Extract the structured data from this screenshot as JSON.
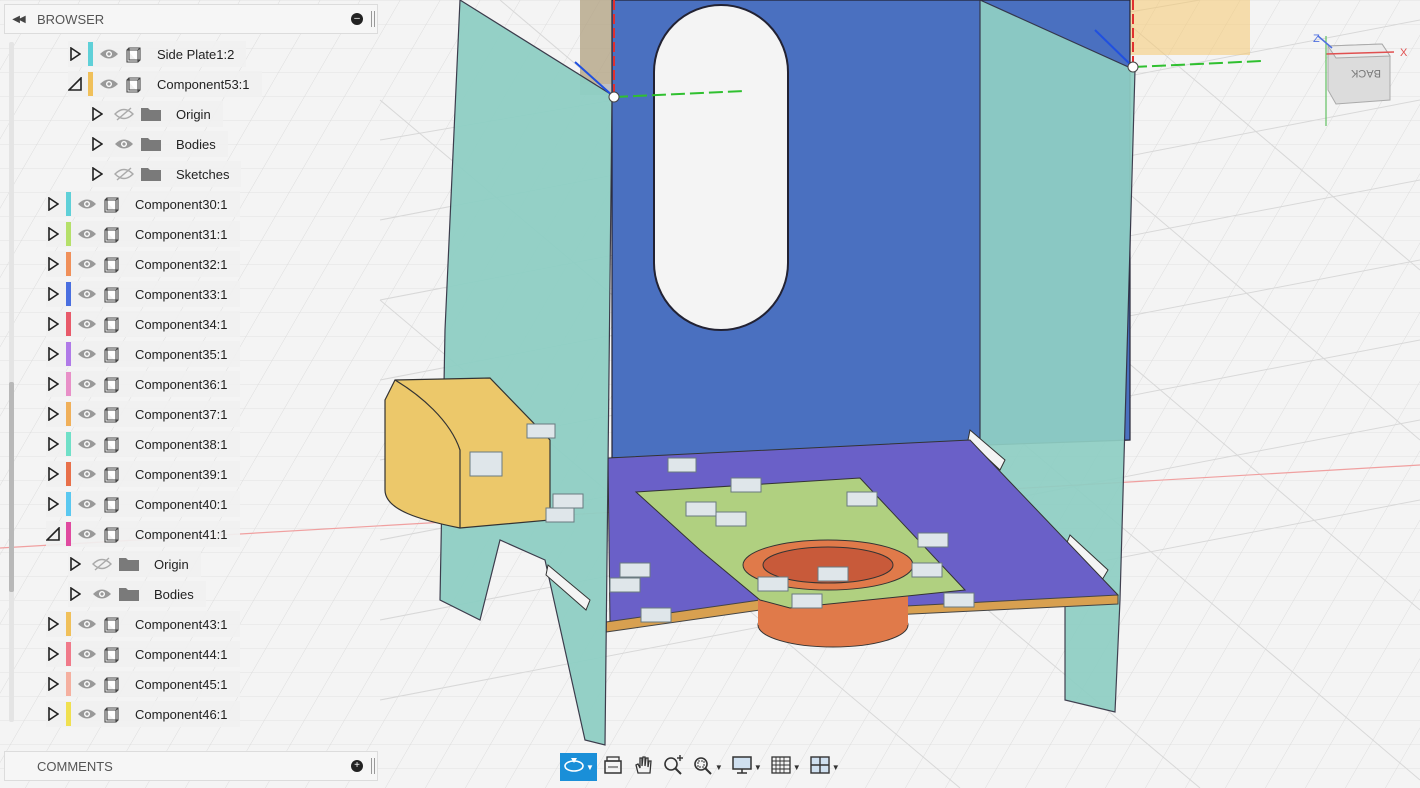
{
  "browser": {
    "title": "BROWSER",
    "tree": [
      {
        "label": "Side Plate1:2",
        "depth": 1,
        "expander": "collapsed",
        "kind": "component",
        "color": "#5fd0d8",
        "visible": true
      },
      {
        "label": "Component53:1",
        "depth": 1,
        "expander": "expanded",
        "kind": "component",
        "color": "#f0c05a",
        "visible": true
      },
      {
        "label": "Origin",
        "depth": 2,
        "expander": "collapsed",
        "kind": "folder",
        "color": null,
        "visible": false
      },
      {
        "label": "Bodies",
        "depth": 2,
        "expander": "collapsed",
        "kind": "folder",
        "color": null,
        "visible": true
      },
      {
        "label": "Sketches",
        "depth": 2,
        "expander": "collapsed",
        "kind": "folder",
        "color": null,
        "visible": false
      },
      {
        "label": "Component30:1",
        "depth": 0,
        "expander": "collapsed",
        "kind": "component",
        "color": "#5fd0d8",
        "visible": true
      },
      {
        "label": "Component31:1",
        "depth": 0,
        "expander": "collapsed",
        "kind": "component",
        "color": "#b5e06a",
        "visible": true
      },
      {
        "label": "Component32:1",
        "depth": 0,
        "expander": "collapsed",
        "kind": "component",
        "color": "#f0905a",
        "visible": true
      },
      {
        "label": "Component33:1",
        "depth": 0,
        "expander": "collapsed",
        "kind": "component",
        "color": "#4a6fe0",
        "visible": true
      },
      {
        "label": "Component34:1",
        "depth": 0,
        "expander": "collapsed",
        "kind": "component",
        "color": "#e85a6a",
        "visible": true
      },
      {
        "label": "Component35:1",
        "depth": 0,
        "expander": "collapsed",
        "kind": "component",
        "color": "#b07ae8",
        "visible": true
      },
      {
        "label": "Component36:1",
        "depth": 0,
        "expander": "collapsed",
        "kind": "component",
        "color": "#e890c8",
        "visible": true
      },
      {
        "label": "Component37:1",
        "depth": 0,
        "expander": "collapsed",
        "kind": "component",
        "color": "#f0b05a",
        "visible": true
      },
      {
        "label": "Component38:1",
        "depth": 0,
        "expander": "collapsed",
        "kind": "component",
        "color": "#70e0c8",
        "visible": true
      },
      {
        "label": "Component39:1",
        "depth": 0,
        "expander": "collapsed",
        "kind": "component",
        "color": "#e8704a",
        "visible": true
      },
      {
        "label": "Component40:1",
        "depth": 0,
        "expander": "collapsed",
        "kind": "component",
        "color": "#5ac8f0",
        "visible": true
      },
      {
        "label": "Component41:1",
        "depth": 0,
        "expander": "expanded",
        "kind": "component",
        "color": "#e04aa0",
        "visible": true
      },
      {
        "label": "Origin",
        "depth": 1,
        "expander": "collapsed",
        "kind": "folder",
        "color": null,
        "visible": false
      },
      {
        "label": "Bodies",
        "depth": 1,
        "expander": "collapsed",
        "kind": "folder",
        "color": null,
        "visible": true
      },
      {
        "label": "Component43:1",
        "depth": 0,
        "expander": "collapsed",
        "kind": "component",
        "color": "#f0c05a",
        "visible": true
      },
      {
        "label": "Component44:1",
        "depth": 0,
        "expander": "collapsed",
        "kind": "component",
        "color": "#f07a8a",
        "visible": true
      },
      {
        "label": "Component45:1",
        "depth": 0,
        "expander": "collapsed",
        "kind": "component",
        "color": "#f5b0a0",
        "visible": true
      },
      {
        "label": "Component46:1",
        "depth": 0,
        "expander": "collapsed",
        "kind": "component",
        "color": "#f0e050",
        "visible": true
      }
    ]
  },
  "comments": {
    "title": "COMMENTS"
  },
  "viewcube": {
    "face_label": "BACK",
    "axis_x": "X",
    "axis_z": "Z"
  },
  "toolbar": [
    {
      "name": "orbit-tool",
      "icon": "orbit-icon",
      "active": true,
      "dropdown": true
    },
    {
      "name": "look-at-tool",
      "icon": "camera-icon",
      "active": false,
      "dropdown": false
    },
    {
      "name": "pan-tool",
      "icon": "hand-icon",
      "active": false,
      "dropdown": false
    },
    {
      "name": "zoom-tool",
      "icon": "zoom-plus-icon",
      "active": false,
      "dropdown": false
    },
    {
      "name": "zoom-window-tool",
      "icon": "zoom-window-icon",
      "active": false,
      "dropdown": true
    },
    {
      "name": "display-settings-tool",
      "icon": "monitor-icon",
      "active": false,
      "dropdown": true
    },
    {
      "name": "grid-settings-tool",
      "icon": "grid-icon",
      "active": false,
      "dropdown": true
    },
    {
      "name": "viewports-tool",
      "icon": "viewports-icon",
      "active": false,
      "dropdown": true
    }
  ],
  "colors": {
    "accent": "#1a8fd8",
    "plate_teal": "#8fcfc4",
    "back_plate": "#4a70c0",
    "base_plate": "#6a60c8",
    "pcb_green": "#b0d080",
    "cup_yellow": "#ecc86a",
    "motor_orange": "#e07a4a"
  }
}
